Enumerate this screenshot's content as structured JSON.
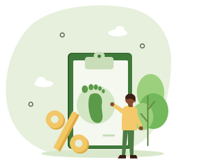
{
  "illustration": {
    "subject": "carbon-footprint-checklist",
    "icons": [
      "blob-background",
      "cloud-icon",
      "clipboard-icon",
      "footprint-icon",
      "percent-icon",
      "person-figure",
      "tree-icon",
      "sparkle-dots"
    ],
    "colors": {
      "background_blob": "#e6f0dc",
      "clipboard_frame": "#3f7a3a",
      "clipboard_frame_dark": "#2f5e2c",
      "clipboard_paper": "#f4f8ef",
      "clip": "#c9ddb9",
      "footprint": "#5a9a48",
      "footprint_circle": "#d3e6c3",
      "percent_gold": "#f2c766",
      "percent_shadow": "#e0a93e",
      "shirt": "#f3c96b",
      "pants": "#4d7d45",
      "skin": "#8a4a2d",
      "hair": "#3a1f14",
      "tree_light": "#9cd07c",
      "tree_dark": "#73b85a",
      "trunk": "#6a8f4a",
      "cloud": "#ffffff",
      "dot_outline": "#3a4a36"
    }
  }
}
